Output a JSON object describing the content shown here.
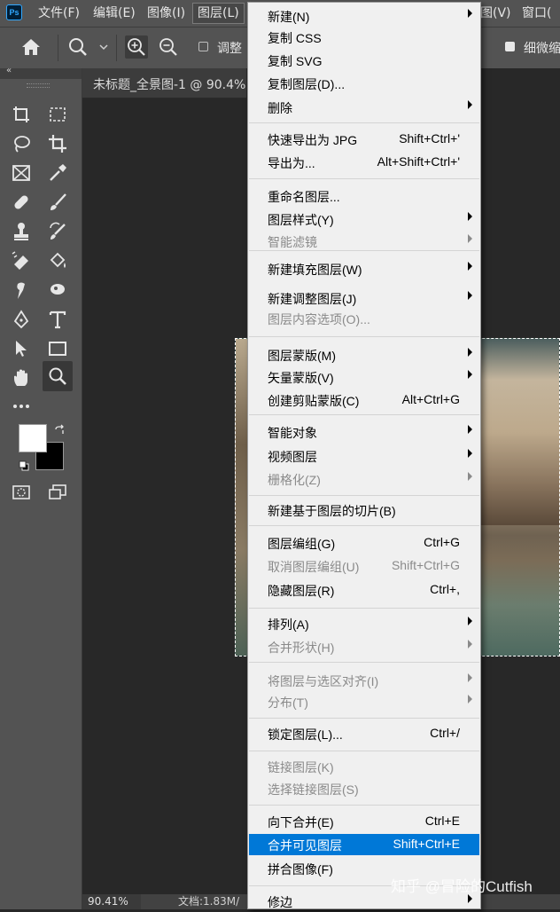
{
  "app": {
    "logo": "Ps"
  },
  "menubar": {
    "items": [
      "文件(F)",
      "编辑(E)",
      "图像(I)",
      "图层(L)",
      "图(V)",
      "窗口("
    ]
  },
  "options": {
    "adjust_label": "调整",
    "fine_label": "细微缩"
  },
  "document": {
    "tab_title": "未标题_全景图-1 @ 90.4%"
  },
  "status": {
    "zoom": "90.41%",
    "doc_info": "文档:1.83M/"
  },
  "layer_menu": {
    "items": [
      {
        "label": "新建(N)",
        "shortcut": "",
        "submenu": true,
        "disabled": false
      },
      {
        "label": "复制 CSS",
        "shortcut": "",
        "submenu": false,
        "disabled": false
      },
      {
        "label": "复制 SVG",
        "shortcut": "",
        "submenu": false,
        "disabled": false
      },
      {
        "label": "复制图层(D)...",
        "shortcut": "",
        "submenu": false,
        "disabled": false
      },
      {
        "label": "删除",
        "shortcut": "",
        "submenu": true,
        "disabled": false
      },
      {
        "label": "快速导出为 JPG",
        "shortcut": "Shift+Ctrl+'",
        "submenu": false,
        "disabled": false
      },
      {
        "label": "导出为...",
        "shortcut": "Alt+Shift+Ctrl+'",
        "submenu": false,
        "disabled": false
      },
      {
        "label": "重命名图层...",
        "shortcut": "",
        "submenu": false,
        "disabled": false
      },
      {
        "label": "图层样式(Y)",
        "shortcut": "",
        "submenu": true,
        "disabled": false
      },
      {
        "label": "智能滤镜",
        "shortcut": "",
        "submenu": true,
        "disabled": true
      },
      {
        "label": "新建填充图层(W)",
        "shortcut": "",
        "submenu": true,
        "disabled": false
      },
      {
        "label": "新建调整图层(J)",
        "shortcut": "",
        "submenu": true,
        "disabled": false
      },
      {
        "label": "图层内容选项(O)...",
        "shortcut": "",
        "submenu": false,
        "disabled": true
      },
      {
        "label": "图层蒙版(M)",
        "shortcut": "",
        "submenu": true,
        "disabled": false
      },
      {
        "label": "矢量蒙版(V)",
        "shortcut": "",
        "submenu": true,
        "disabled": false
      },
      {
        "label": "创建剪贴蒙版(C)",
        "shortcut": "Alt+Ctrl+G",
        "submenu": false,
        "disabled": false
      },
      {
        "label": "智能对象",
        "shortcut": "",
        "submenu": true,
        "disabled": false
      },
      {
        "label": "视频图层",
        "shortcut": "",
        "submenu": true,
        "disabled": false
      },
      {
        "label": "栅格化(Z)",
        "shortcut": "",
        "submenu": true,
        "disabled": true
      },
      {
        "label": "新建基于图层的切片(B)",
        "shortcut": "",
        "submenu": false,
        "disabled": false
      },
      {
        "label": "图层编组(G)",
        "shortcut": "Ctrl+G",
        "submenu": false,
        "disabled": false
      },
      {
        "label": "取消图层编组(U)",
        "shortcut": "Shift+Ctrl+G",
        "submenu": false,
        "disabled": true
      },
      {
        "label": "隐藏图层(R)",
        "shortcut": "Ctrl+,",
        "submenu": false,
        "disabled": false
      },
      {
        "label": "排列(A)",
        "shortcut": "",
        "submenu": true,
        "disabled": false
      },
      {
        "label": "合并形状(H)",
        "shortcut": "",
        "submenu": true,
        "disabled": true
      },
      {
        "label": "将图层与选区对齐(I)",
        "shortcut": "",
        "submenu": true,
        "disabled": true
      },
      {
        "label": "分布(T)",
        "shortcut": "",
        "submenu": true,
        "disabled": true
      },
      {
        "label": "锁定图层(L)...",
        "shortcut": "Ctrl+/",
        "submenu": false,
        "disabled": false
      },
      {
        "label": "链接图层(K)",
        "shortcut": "",
        "submenu": false,
        "disabled": true
      },
      {
        "label": "选择链接图层(S)",
        "shortcut": "",
        "submenu": false,
        "disabled": true
      },
      {
        "label": "向下合并(E)",
        "shortcut": "Ctrl+E",
        "submenu": false,
        "disabled": false
      },
      {
        "label": "合并可见图层",
        "shortcut": "Shift+Ctrl+E",
        "submenu": false,
        "disabled": false,
        "highlighted": true
      },
      {
        "label": "拼合图像(F)",
        "shortcut": "",
        "submenu": false,
        "disabled": false
      },
      {
        "label": "修边",
        "shortcut": "",
        "submenu": true,
        "disabled": false
      }
    ]
  },
  "watermark": "知乎 @冒险的Cutfish",
  "colors": {
    "foreground": "#ffffff",
    "background": "#000000",
    "highlight": "#0078d7"
  }
}
